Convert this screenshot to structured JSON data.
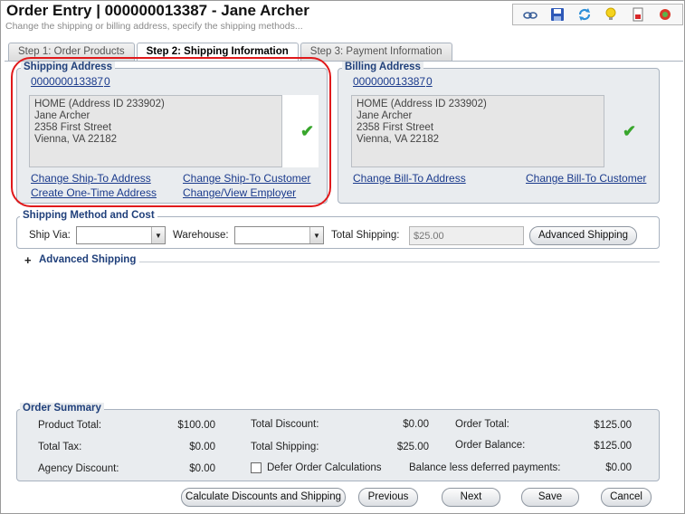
{
  "header": {
    "title": "Order Entry | 000000013387 - Jane Archer",
    "subtitle": "Change the shipping or billing address, specify the shipping methods..."
  },
  "toolbar": {
    "icons": [
      "view-icon",
      "save-icon",
      "refresh-icon",
      "lightbulb-icon",
      "report-icon",
      "help-icon"
    ]
  },
  "tabs": [
    {
      "label": "Step 1: Order Products"
    },
    {
      "label": "Step 2: Shipping Information"
    },
    {
      "label": "Step 3: Payment Information"
    }
  ],
  "shipping": {
    "legend": "Shipping Address",
    "customer_id": "000000013387",
    "address_index": "0",
    "address_lines": [
      "HOME (Address ID 233902)",
      "Jane Archer",
      "2358 First Street",
      "Vienna, VA 22182"
    ],
    "links": {
      "change_address": "Change Ship-To Address",
      "change_customer": "Change Ship-To Customer",
      "one_time": "Create One-Time Address",
      "employer": "Change/View Employer"
    }
  },
  "billing": {
    "legend": "Billing Address",
    "customer_id": "000000013387",
    "address_index": "0",
    "address_lines": [
      "HOME (Address ID 233902)",
      "Jane Archer",
      "2358 First Street",
      "Vienna, VA 22182"
    ],
    "links": {
      "change_address": "Change Bill-To Address",
      "change_customer": "Change Bill-To Customer"
    }
  },
  "shipping_method": {
    "legend": "Shipping Method and Cost",
    "ship_via_label": "Ship Via:",
    "ship_via_value": "",
    "warehouse_label": "Warehouse:",
    "warehouse_value": "",
    "total_shipping_label": "Total Shipping:",
    "total_shipping_value": "$25.00",
    "advanced_button": "Advanced Shipping"
  },
  "advanced_section": {
    "toggle": "+",
    "label": "Advanced Shipping"
  },
  "order_summary": {
    "legend": "Order Summary",
    "product_total_label": "Product Total:",
    "product_total": "$100.00",
    "total_tax_label": "Total Tax:",
    "total_tax": "$0.00",
    "agency_discount_label": "Agency Discount:",
    "agency_discount": "$0.00",
    "total_discount_label": "Total Discount:",
    "total_discount": "$0.00",
    "total_shipping_label": "Total Shipping:",
    "total_shipping": "$25.00",
    "defer_label": "Defer Order Calculations",
    "order_total_label": "Order Total:",
    "order_total": "$125.00",
    "order_balance_label": "Order Balance:",
    "order_balance": "$125.00",
    "balance_deferred_label": "Balance less deferred payments:",
    "balance_deferred": "$0.00"
  },
  "buttons": {
    "calculate": "Calculate Discounts and Shipping",
    "previous": "Previous",
    "next": "Next",
    "save": "Save",
    "cancel": "Cancel"
  },
  "colors": {
    "highlight_ring": "#e0191b",
    "link": "#1a3a8c",
    "legend": "#1f3f7a",
    "check": "#38a62c"
  }
}
